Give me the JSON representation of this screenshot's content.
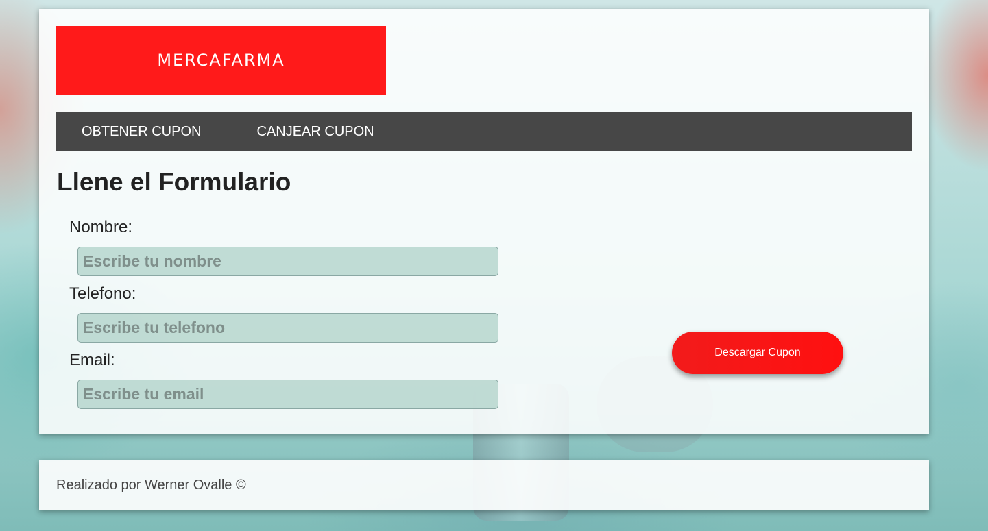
{
  "brand": {
    "name": "MERCAFARMA",
    "color": "#ff1a1a"
  },
  "nav": {
    "items": [
      {
        "label": "OBTENER CUPON"
      },
      {
        "label": "CANJEAR CUPON"
      }
    ]
  },
  "form": {
    "title": "Llene el Formulario",
    "fields": [
      {
        "label": "Nombre:",
        "value": "",
        "placeholder": "Escribe tu nombre"
      },
      {
        "label": "Telefono:",
        "value": "",
        "placeholder": "Escribe tu telefono"
      },
      {
        "label": "Email:",
        "value": "",
        "placeholder": "Escribe tu email"
      }
    ],
    "submit_label": "Descargar Cupon"
  },
  "footer": {
    "text": "Realizado por Werner Ovalle ©"
  }
}
